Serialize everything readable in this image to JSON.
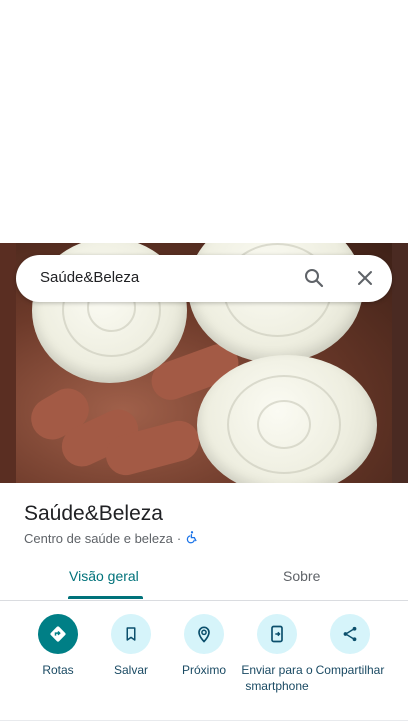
{
  "search": {
    "value": "Saúde&Beleza"
  },
  "place": {
    "title": "Saúde&Beleza",
    "category": "Centro de saúde e beleza",
    "separator": "·"
  },
  "tabs": [
    {
      "label": "Visão geral",
      "active": true
    },
    {
      "label": "Sobre",
      "active": false
    }
  ],
  "actions": [
    {
      "label": "Rotas",
      "icon": "directions-icon"
    },
    {
      "label": "Salvar",
      "icon": "bookmark-icon"
    },
    {
      "label": "Próximo",
      "icon": "nearby-icon"
    },
    {
      "label": "Enviar para o smartphone",
      "icon": "send-to-phone-icon"
    },
    {
      "label": "Compartilhar",
      "icon": "share-icon"
    }
  ],
  "colors": {
    "accent": "#00727a",
    "action_bg": "#d6f4fa",
    "primary_action": "#007f86"
  }
}
